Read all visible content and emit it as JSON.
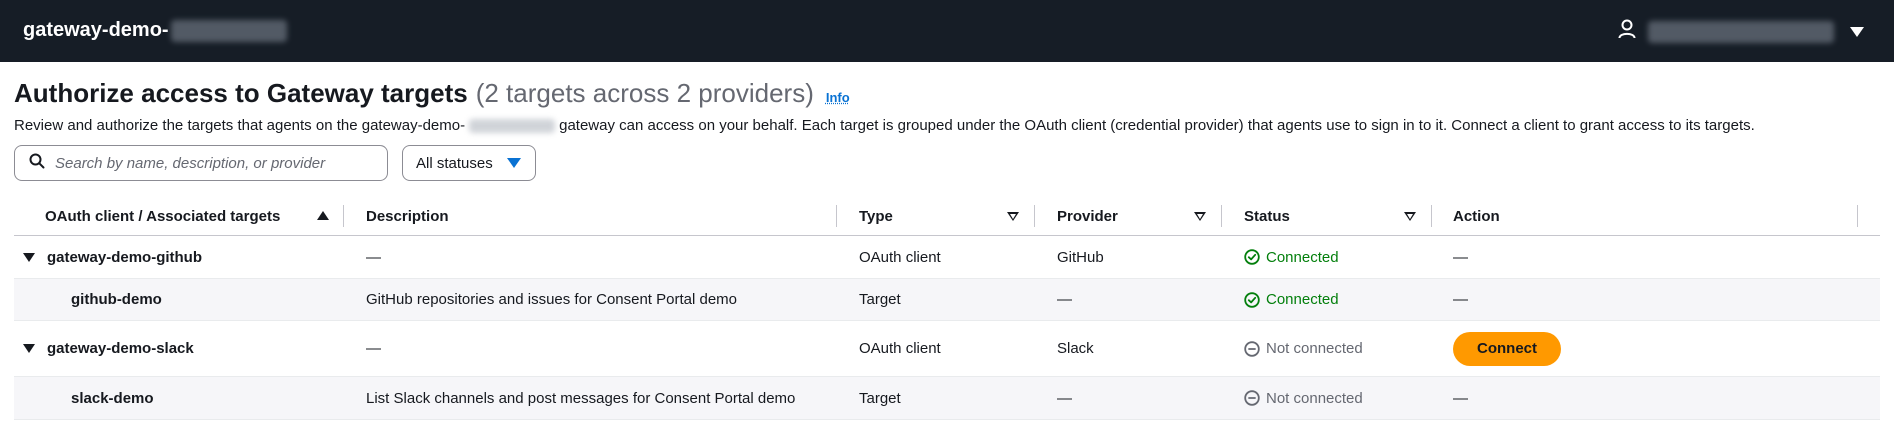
{
  "topbar": {
    "app_title": "gateway-demo-"
  },
  "header": {
    "title": "Authorize access to Gateway targets",
    "count": "(2 targets across 2 providers)",
    "info_link": "Info",
    "description_before": "Review and authorize the targets that agents on the gateway-demo-",
    "description_after": "gateway can access on your behalf. Each target is grouped under the OAuth client (credential provider) that agents use to sign in to it. Connect a client to grant access to its targets."
  },
  "filters": {
    "search_placeholder": "Search by name, description, or provider",
    "status_select": "All statuses"
  },
  "table": {
    "columns": {
      "name": "OAuth client / Associated targets",
      "description": "Description",
      "type": "Type",
      "provider": "Provider",
      "status": "Status",
      "action": "Action"
    },
    "rows": [
      {
        "name": "gateway-demo-github",
        "description": "—",
        "type": "OAuth client",
        "provider": "GitHub",
        "status": "Connected",
        "action": "—"
      },
      {
        "name": "github-demo",
        "description": "GitHub repositories and issues for Consent Portal demo",
        "type": "Target",
        "provider": "—",
        "status": "Connected",
        "action": "—"
      },
      {
        "name": "gateway-demo-slack",
        "description": "—",
        "type": "OAuth client",
        "provider": "Slack",
        "status": "Not connected",
        "action": "Connect"
      },
      {
        "name": "slack-demo",
        "description": "List Slack channels and post messages for Consent Portal demo",
        "type": "Target",
        "provider": "—",
        "status": "Not connected",
        "action": "—"
      }
    ]
  },
  "colors": {
    "topbar_bg": "#161d26",
    "connected": "#037f0c",
    "not_connected": "#656871",
    "connect_button": "#ff9900",
    "link": "#0972d3"
  }
}
